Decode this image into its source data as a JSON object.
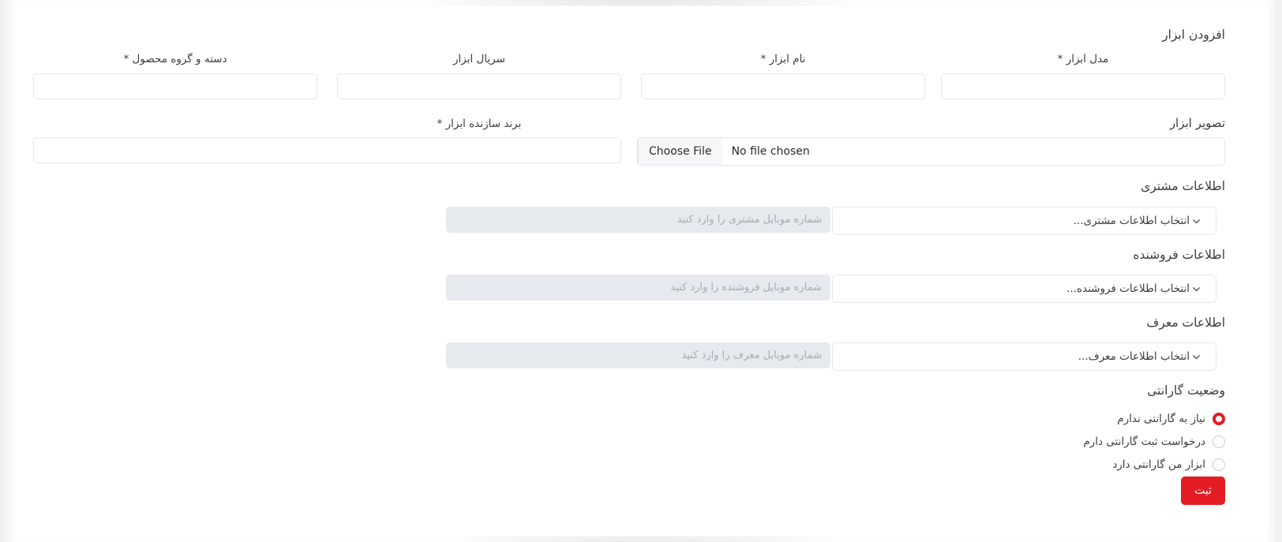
{
  "form": {
    "title": "افزودن ابزار",
    "fields_row1": [
      {
        "label": "مدل ابزار *",
        "value": "",
        "placeholder": "",
        "name": "tool-model"
      },
      {
        "label": "نام ابزار *",
        "value": "",
        "placeholder": "",
        "name": "tool-name"
      },
      {
        "label": "سریال ابزار",
        "value": "",
        "placeholder": "",
        "name": "tool-serial"
      },
      {
        "label": "دسته و گروه محصول *",
        "value": "",
        "placeholder": "",
        "name": "product-category"
      }
    ],
    "image_label": "تصویر ابزار",
    "file_input": {
      "button_label": "Choose File",
      "status_text": "No file chosen"
    },
    "brand_label": "برند سازنده ابزار *",
    "brand_value": "",
    "sections": [
      {
        "title": "اطلاعات مشتری",
        "select_placeholder": "انتخاب اطلاعات مشتری...",
        "mobile_placeholder": "شماره موبایل مشتری را وارد کنید",
        "mobile_value": ""
      },
      {
        "title": "اطلاعات فروشنده",
        "select_placeholder": "انتخاب اطلاعات فروشنده...",
        "mobile_placeholder": "شماره موبایل فروشنده را وارد کنید",
        "mobile_value": ""
      },
      {
        "title": "اطلاعات معرف",
        "select_placeholder": "انتخاب اطلاعات معرف...",
        "mobile_placeholder": "شماره موبایل معرف را وارد کنید",
        "mobile_value": ""
      }
    ],
    "warranty": {
      "title": "وضعیت گارانتی",
      "options": [
        {
          "label": "نیاز به گارانتی ندارم",
          "selected": true
        },
        {
          "label": "درخواست ثبت گارانتی دارم",
          "selected": false
        },
        {
          "label": "ابزار من گارانتی دارد",
          "selected": false
        }
      ]
    },
    "submit_label": "ثبت"
  },
  "colors": {
    "accent": "#e41d25",
    "text": "#3c3c3c",
    "border": "#e3e6ea",
    "disabled_bg": "#e6e9ed",
    "placeholder": "#b4bcc6"
  }
}
